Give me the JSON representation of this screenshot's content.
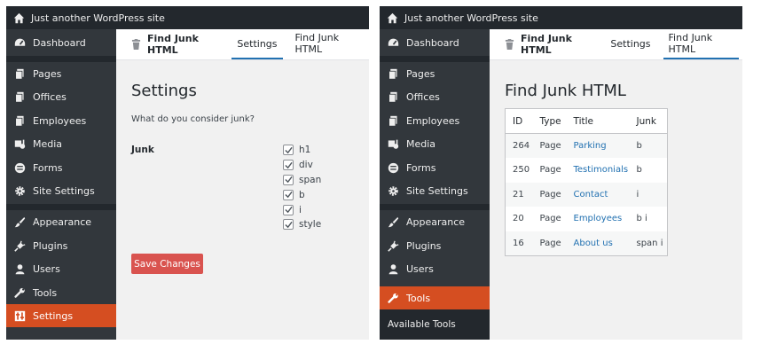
{
  "site_title": "Just another WordPress site",
  "menu": {
    "dashboard": "Dashboard",
    "pages": "Pages",
    "offices": "Offices",
    "employees": "Employees",
    "media": "Media",
    "forms": "Forms",
    "site_settings": "Site Settings",
    "appearance": "Appearance",
    "plugins": "Plugins",
    "users": "Users",
    "tools": "Tools",
    "settings": "Settings"
  },
  "left": {
    "header_title": "Find Junk HTML",
    "tabs": [
      "Settings",
      "Find Junk HTML"
    ],
    "active_tab": "Settings",
    "active_menu": "Settings",
    "page_title": "Settings",
    "question": "What do you consider junk?",
    "field_label": "Junk",
    "junk_options": [
      {
        "label": "h1",
        "checked": true
      },
      {
        "label": "div",
        "checked": true
      },
      {
        "label": "span",
        "checked": true
      },
      {
        "label": "b",
        "checked": true
      },
      {
        "label": "i",
        "checked": true
      },
      {
        "label": "style",
        "checked": true
      }
    ],
    "save_label": "Save Changes"
  },
  "right": {
    "header_title": "Find Junk HTML",
    "tabs": [
      "Settings",
      "Find Junk HTML"
    ],
    "active_tab": "Find Junk HTML",
    "active_menu": "Tools",
    "submenu_item": "Available Tools",
    "page_title": "Find Junk HTML",
    "table": {
      "columns": [
        "ID",
        "Type",
        "Title",
        "Junk"
      ],
      "rows": [
        {
          "id": "264",
          "type": "Page",
          "title": "Parking",
          "junk": "b"
        },
        {
          "id": "250",
          "type": "Page",
          "title": "Testimonials",
          "junk": "b"
        },
        {
          "id": "21",
          "type": "Page",
          "title": "Contact",
          "junk": "i"
        },
        {
          "id": "20",
          "type": "Page",
          "title": "Employees",
          "junk": "b i"
        },
        {
          "id": "16",
          "type": "Page",
          "title": "About us",
          "junk": "span i"
        }
      ]
    }
  },
  "colors": {
    "adminbar": "#23282d",
    "sidebar": "#32373c",
    "active_menu": "#d54e21",
    "save_button": "#d9534f",
    "link": "#2271b1",
    "content_bg": "#f1f1f1"
  },
  "icons": {
    "home": "home-icon",
    "dashboard": "gauge-icon",
    "pages": "pages-icon",
    "media": "media-icon",
    "forms": "forms-icon",
    "settings_gear": "gear-icon",
    "appearance": "brush-icon",
    "plugins": "plug-icon",
    "users": "user-icon",
    "tools": "wrench-icon",
    "settings": "settings-sliders-icon",
    "trash": "trash-icon",
    "checkbox": "checkmark-icon"
  }
}
